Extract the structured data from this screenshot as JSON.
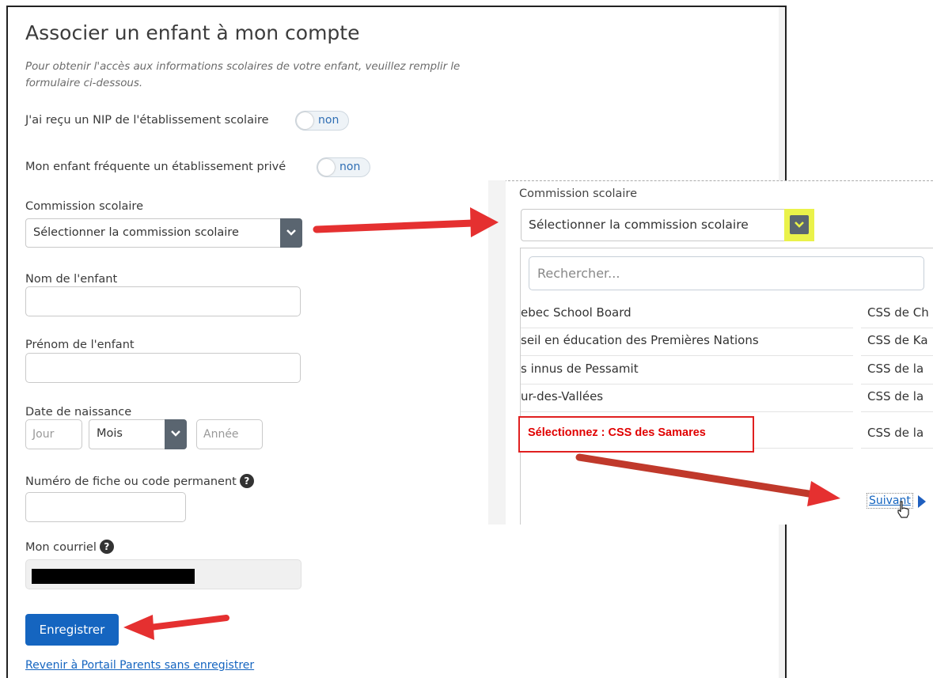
{
  "form": {
    "title": "Associer un enfant à mon compte",
    "subtitle": "Pour obtenir l'accès aux informations scolaires de votre enfant, veuillez remplir le formulaire ci-dessous.",
    "nip_label": "J'ai reçu un NIP de l'établissement scolaire",
    "nip_toggle": "non",
    "private_label": "Mon enfant fréquente un établissement privé",
    "private_toggle": "non",
    "commission_label": "Commission scolaire",
    "commission_select": "Sélectionner la commission scolaire",
    "child_name_label": "Nom de l'enfant",
    "child_firstname_label": "Prénom de l'enfant",
    "birthdate_label": "Date de naissance",
    "day_placeholder": "Jour",
    "month_select": "Mois",
    "year_placeholder": "Année",
    "file_number_label": "Numéro de fiche ou code permanent",
    "email_label": "Mon courriel",
    "help_glyph": "?",
    "save_button": "Enregistrer",
    "back_link": "Revenir à Portail Parents sans enregistrer"
  },
  "inset": {
    "commission_label": "Commission scolaire",
    "commission_select": "Sélectionner la commission scolaire",
    "search_placeholder": "Rechercher...",
    "left_items": [
      "ebec School Board",
      "seil en éducation des Premières Nations",
      "s innus de Pessamit",
      "ur-des-Vallées"
    ],
    "right_items": [
      "CSS de Ch",
      "CSS de Ka",
      "CSS de la",
      "CSS de la",
      "CSS de la"
    ],
    "highlight_text": "Sélectionnez : CSS des Samares",
    "next_link": "Suivant"
  },
  "colors": {
    "primary": "#1565c0",
    "annotation_red": "#e53030",
    "highlight_yellow": "#eaf24a",
    "select_arrow": "#5a6570"
  }
}
